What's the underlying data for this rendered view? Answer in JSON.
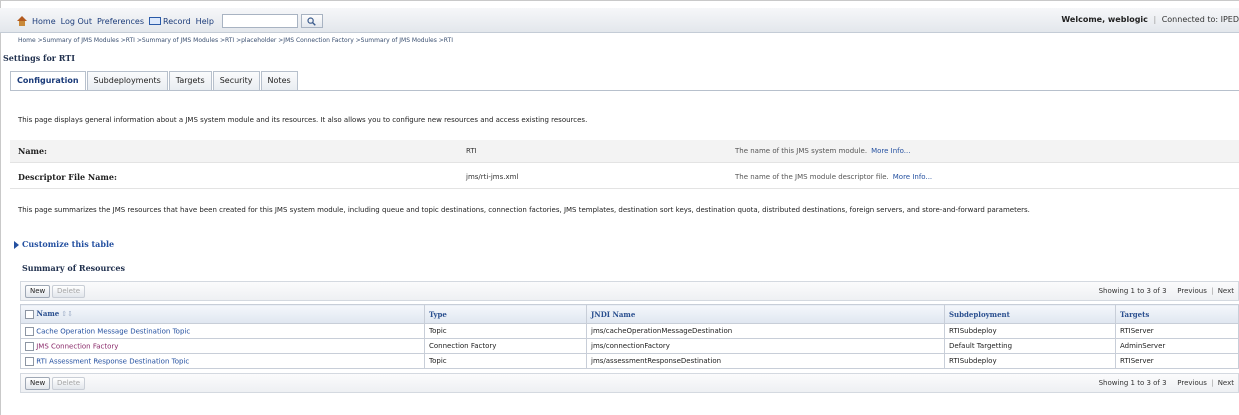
{
  "topbar": {
    "nav": [
      "Home",
      "Log Out",
      "Preferences",
      "Record",
      "Help"
    ],
    "search_value": "",
    "welcome_prefix": "Welcome, weblogic",
    "connected": "Connected to: IPED"
  },
  "breadcrumb": "Home >Summary of JMS Modules >RTI >Summary of JMS Modules >RTI >placeholder >JMS Connection Factory >Summary of JMS Modules >RTI",
  "settings_title": "Settings for RTI",
  "tabs": [
    "Configuration",
    "Subdeployments",
    "Targets",
    "Security",
    "Notes"
  ],
  "intro": "This page displays general information about a JMS system module and its resources. It also allows you to configure new resources and access existing resources.",
  "properties": [
    {
      "label": "Name:",
      "value": "RTI",
      "hint": "The name of this JMS system module.",
      "more": "More Info..."
    },
    {
      "label": "Descriptor File Name:",
      "value": "jms/rti-jms.xml",
      "hint": "The name of the JMS module descriptor file.",
      "more": "More Info..."
    }
  ],
  "summary_text": "This page summarizes the JMS resources that have been created for this JMS system module, including queue and topic destinations, connection factories, JMS templates, destination sort keys, destination quota, distributed destinations, foreign servers, and store-and-forward parameters.",
  "customize": "Customize this table",
  "resources": {
    "title": "Summary of Resources",
    "new_label": "New",
    "delete_label": "Delete",
    "paging": "Showing 1 to 3 of 3",
    "previous": "Previous",
    "next": "Next",
    "columns": [
      "Name",
      "Type",
      "JNDI Name",
      "Subdeployment",
      "Targets"
    ],
    "rows": [
      {
        "name": "Cache Operation Message Destination Topic",
        "type": "Topic",
        "jndi": "jms/cacheOperationMessageDestination",
        "sub": "RTISubdeploy",
        "targets": "RTIServer"
      },
      {
        "name": "JMS Connection Factory",
        "type": "Connection Factory",
        "jndi": "jms/connectionFactory",
        "sub": "Default Targetting",
        "targets": "AdminServer"
      },
      {
        "name": "RTI Assessment Response Destination Topic",
        "type": "Topic",
        "jndi": "jms/assessmentResponseDestination",
        "sub": "RTISubdeploy",
        "targets": "RTIServer"
      }
    ]
  }
}
